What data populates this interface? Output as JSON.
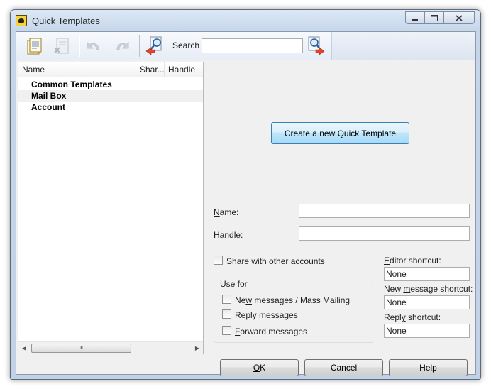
{
  "window": {
    "title": "Quick Templates"
  },
  "toolbar": {
    "search_label": "Search",
    "search_value": ""
  },
  "tree": {
    "columns": [
      "Name",
      "Shar...",
      "Handle"
    ],
    "rows": [
      "Common Templates",
      "Mail Box",
      "Account"
    ],
    "scroll_grip": "III"
  },
  "actions": {
    "create": "Create a new Quick Template"
  },
  "form": {
    "name_label_u": "N",
    "name_label_rest": "ame:",
    "name_value": "",
    "handle_label_u": "H",
    "handle_label_rest": "andle:",
    "handle_value": "",
    "share_u": "S",
    "share_rest": "hare with other accounts",
    "use_for": "Use for",
    "new_pre": "Ne",
    "new_u": "w",
    "new_post": " messages / Mass Mailing",
    "reply_u": "R",
    "reply_rest": "eply messages",
    "forward_u": "F",
    "forward_rest": "orward messages",
    "editor_u": "E",
    "editor_rest": "ditor shortcut:",
    "editor_value": "None",
    "newmsg_pre": "New ",
    "newmsg_u": "m",
    "newmsg_post": "essage shortcut:",
    "newmsg_value": "None",
    "replyshort_pre": "Repl",
    "replyshort_u": "y",
    "replyshort_post": " shortcut:",
    "replyshort_value": "None"
  },
  "buttons": {
    "ok_u": "O",
    "ok_rest": "K",
    "cancel": "Cancel",
    "help": "Help"
  },
  "colors": {
    "accent": "#3c7fb1",
    "button_face": "#d9f0fc",
    "title_bg": "#c6d6ea"
  }
}
